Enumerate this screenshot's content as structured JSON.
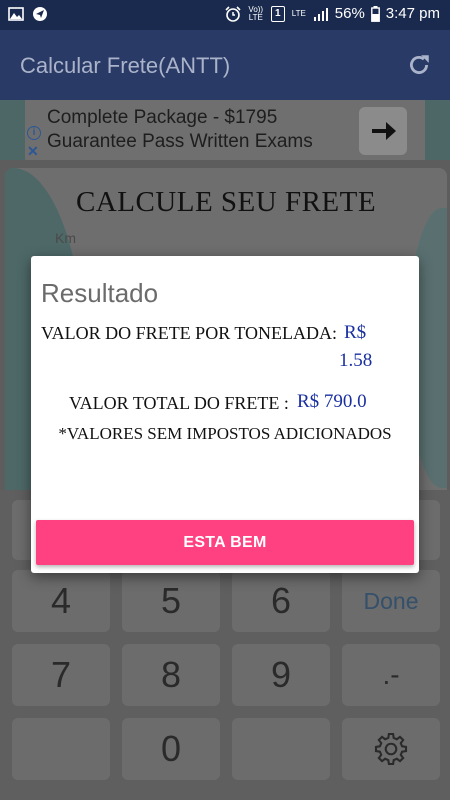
{
  "status_bar": {
    "network_label": "Vo)) LTE",
    "sim_label": "1",
    "lte_label": "LTE",
    "battery": "56%",
    "time": "3:47 pm"
  },
  "app_bar": {
    "title": "Calcular Frete(ANTT)",
    "refresh_icon": "refresh-icon"
  },
  "ad": {
    "line1": "Complete Package - $1795",
    "line2": "Guarantee Pass Written Exams",
    "info_icon": "i",
    "close_icon": "✕",
    "arrow_icon": "arrow-right-icon"
  },
  "form": {
    "heading": "CALCULE SEU FRETE",
    "km_label": "Km"
  },
  "dialog": {
    "title": "Resultado",
    "per_ton_label": "VALOR DO FRETE POR TONELADA:",
    "per_ton_currency": "R$",
    "per_ton_value": "1.58",
    "total_label": "VALOR TOTAL DO FRETE :",
    "total_value": "R$ 790.0",
    "note": "*VALORES SEM IMPOSTOS ADICIONADOS",
    "ok_button": "ESTA BEM"
  },
  "keypad": {
    "keys": [
      "4",
      "5",
      "6",
      "Done",
      "7",
      "8",
      "9",
      ".-",
      "0"
    ],
    "settings_icon": "gear-icon"
  },
  "colors": {
    "accent": "#ff4081",
    "value_blue": "#1a2fa0",
    "app_bar": "#2a3a66"
  }
}
